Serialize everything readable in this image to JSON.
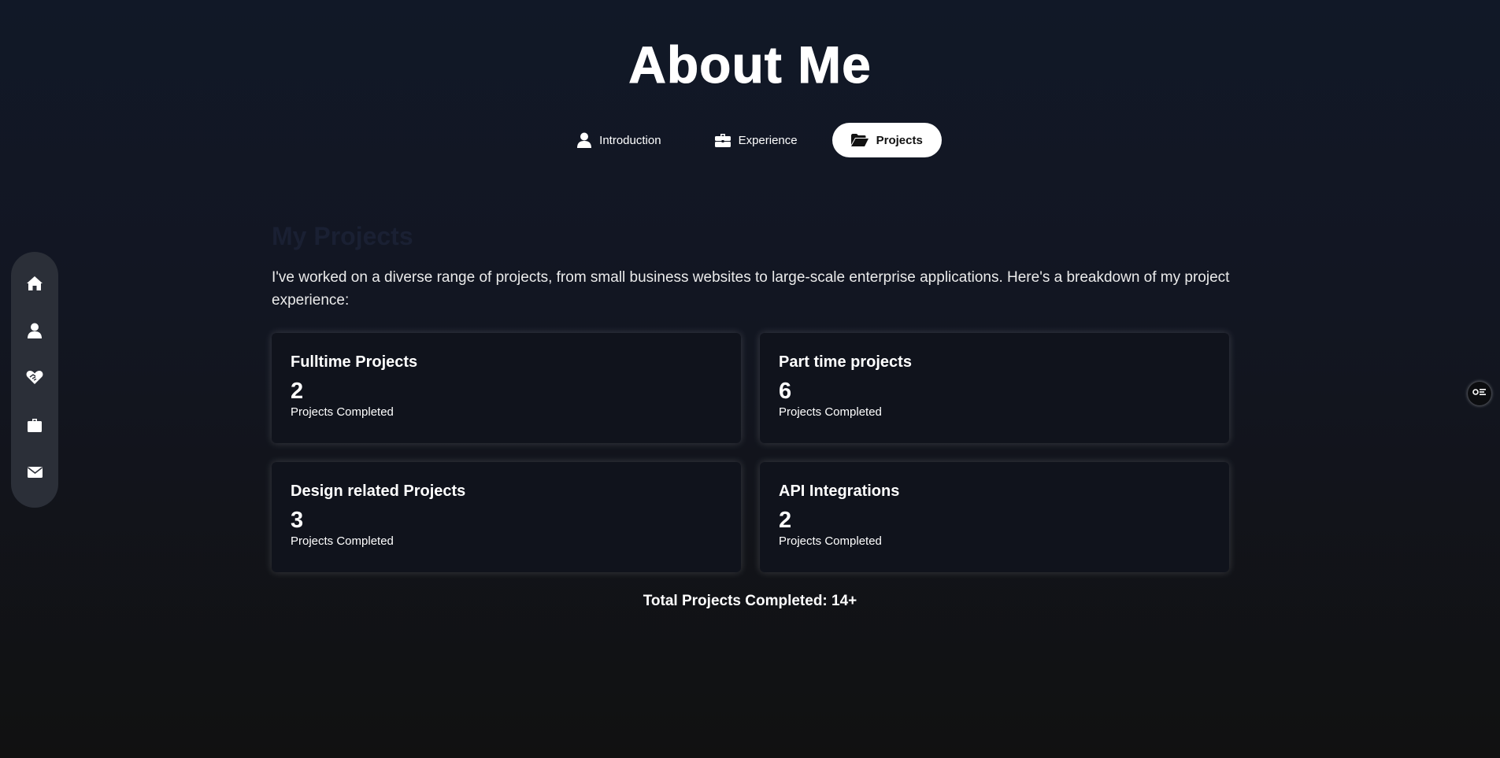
{
  "header": {
    "title": "About Me"
  },
  "tabs": [
    {
      "label": "Introduction",
      "icon": "user-icon",
      "active": false
    },
    {
      "label": "Experience",
      "icon": "briefcase-icon",
      "active": false
    },
    {
      "label": "Projects",
      "icon": "folder-open-icon",
      "active": true
    }
  ],
  "section": {
    "heading": "My Projects",
    "intro": "I've worked on a diverse range of projects, from small business websites to large-scale enterprise applications. Here's a breakdown of my project experience:"
  },
  "cards": [
    {
      "title": "Fulltime Projects",
      "count": "2",
      "label": "Projects Completed"
    },
    {
      "title": "Part time projects",
      "count": "6",
      "label": "Projects Completed"
    },
    {
      "title": "Design related Projects",
      "count": "3",
      "label": "Projects Completed"
    },
    {
      "title": "API Integrations",
      "count": "2",
      "label": "Projects Completed"
    }
  ],
  "total": "Total Projects Completed: 14+",
  "sidebar": {
    "items": [
      {
        "icon": "home-icon"
      },
      {
        "icon": "user-icon"
      },
      {
        "icon": "handshake-heart-icon"
      },
      {
        "icon": "briefcase-icon"
      },
      {
        "icon": "envelope-icon"
      }
    ]
  },
  "floating": {
    "icon": "settings-toggle-icon"
  },
  "colors": {
    "background_top": "#111827",
    "background_bottom": "#111111",
    "card_background": "#10131c",
    "sidebar_background": "#2b2f38",
    "active_tab_background": "#ffffff",
    "heading_faded": "#1a2033"
  }
}
